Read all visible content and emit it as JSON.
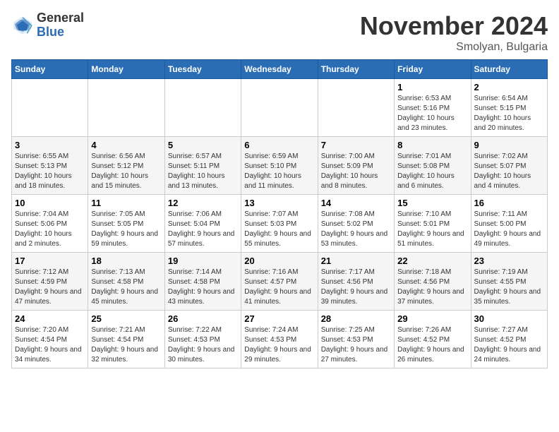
{
  "header": {
    "logo_general": "General",
    "logo_blue": "Blue",
    "month_title": "November 2024",
    "subtitle": "Smolyan, Bulgaria"
  },
  "calendar": {
    "days_of_week": [
      "Sunday",
      "Monday",
      "Tuesday",
      "Wednesday",
      "Thursday",
      "Friday",
      "Saturday"
    ],
    "weeks": [
      [
        {
          "day": "",
          "info": ""
        },
        {
          "day": "",
          "info": ""
        },
        {
          "day": "",
          "info": ""
        },
        {
          "day": "",
          "info": ""
        },
        {
          "day": "",
          "info": ""
        },
        {
          "day": "1",
          "info": "Sunrise: 6:53 AM\nSunset: 5:16 PM\nDaylight: 10 hours and 23 minutes."
        },
        {
          "day": "2",
          "info": "Sunrise: 6:54 AM\nSunset: 5:15 PM\nDaylight: 10 hours and 20 minutes."
        }
      ],
      [
        {
          "day": "3",
          "info": "Sunrise: 6:55 AM\nSunset: 5:13 PM\nDaylight: 10 hours and 18 minutes."
        },
        {
          "day": "4",
          "info": "Sunrise: 6:56 AM\nSunset: 5:12 PM\nDaylight: 10 hours and 15 minutes."
        },
        {
          "day": "5",
          "info": "Sunrise: 6:57 AM\nSunset: 5:11 PM\nDaylight: 10 hours and 13 minutes."
        },
        {
          "day": "6",
          "info": "Sunrise: 6:59 AM\nSunset: 5:10 PM\nDaylight: 10 hours and 11 minutes."
        },
        {
          "day": "7",
          "info": "Sunrise: 7:00 AM\nSunset: 5:09 PM\nDaylight: 10 hours and 8 minutes."
        },
        {
          "day": "8",
          "info": "Sunrise: 7:01 AM\nSunset: 5:08 PM\nDaylight: 10 hours and 6 minutes."
        },
        {
          "day": "9",
          "info": "Sunrise: 7:02 AM\nSunset: 5:07 PM\nDaylight: 10 hours and 4 minutes."
        }
      ],
      [
        {
          "day": "10",
          "info": "Sunrise: 7:04 AM\nSunset: 5:06 PM\nDaylight: 10 hours and 2 minutes."
        },
        {
          "day": "11",
          "info": "Sunrise: 7:05 AM\nSunset: 5:05 PM\nDaylight: 9 hours and 59 minutes."
        },
        {
          "day": "12",
          "info": "Sunrise: 7:06 AM\nSunset: 5:04 PM\nDaylight: 9 hours and 57 minutes."
        },
        {
          "day": "13",
          "info": "Sunrise: 7:07 AM\nSunset: 5:03 PM\nDaylight: 9 hours and 55 minutes."
        },
        {
          "day": "14",
          "info": "Sunrise: 7:08 AM\nSunset: 5:02 PM\nDaylight: 9 hours and 53 minutes."
        },
        {
          "day": "15",
          "info": "Sunrise: 7:10 AM\nSunset: 5:01 PM\nDaylight: 9 hours and 51 minutes."
        },
        {
          "day": "16",
          "info": "Sunrise: 7:11 AM\nSunset: 5:00 PM\nDaylight: 9 hours and 49 minutes."
        }
      ],
      [
        {
          "day": "17",
          "info": "Sunrise: 7:12 AM\nSunset: 4:59 PM\nDaylight: 9 hours and 47 minutes."
        },
        {
          "day": "18",
          "info": "Sunrise: 7:13 AM\nSunset: 4:58 PM\nDaylight: 9 hours and 45 minutes."
        },
        {
          "day": "19",
          "info": "Sunrise: 7:14 AM\nSunset: 4:58 PM\nDaylight: 9 hours and 43 minutes."
        },
        {
          "day": "20",
          "info": "Sunrise: 7:16 AM\nSunset: 4:57 PM\nDaylight: 9 hours and 41 minutes."
        },
        {
          "day": "21",
          "info": "Sunrise: 7:17 AM\nSunset: 4:56 PM\nDaylight: 9 hours and 39 minutes."
        },
        {
          "day": "22",
          "info": "Sunrise: 7:18 AM\nSunset: 4:56 PM\nDaylight: 9 hours and 37 minutes."
        },
        {
          "day": "23",
          "info": "Sunrise: 7:19 AM\nSunset: 4:55 PM\nDaylight: 9 hours and 35 minutes."
        }
      ],
      [
        {
          "day": "24",
          "info": "Sunrise: 7:20 AM\nSunset: 4:54 PM\nDaylight: 9 hours and 34 minutes."
        },
        {
          "day": "25",
          "info": "Sunrise: 7:21 AM\nSunset: 4:54 PM\nDaylight: 9 hours and 32 minutes."
        },
        {
          "day": "26",
          "info": "Sunrise: 7:22 AM\nSunset: 4:53 PM\nDaylight: 9 hours and 30 minutes."
        },
        {
          "day": "27",
          "info": "Sunrise: 7:24 AM\nSunset: 4:53 PM\nDaylight: 9 hours and 29 minutes."
        },
        {
          "day": "28",
          "info": "Sunrise: 7:25 AM\nSunset: 4:53 PM\nDaylight: 9 hours and 27 minutes."
        },
        {
          "day": "29",
          "info": "Sunrise: 7:26 AM\nSunset: 4:52 PM\nDaylight: 9 hours and 26 minutes."
        },
        {
          "day": "30",
          "info": "Sunrise: 7:27 AM\nSunset: 4:52 PM\nDaylight: 9 hours and 24 minutes."
        }
      ]
    ]
  }
}
